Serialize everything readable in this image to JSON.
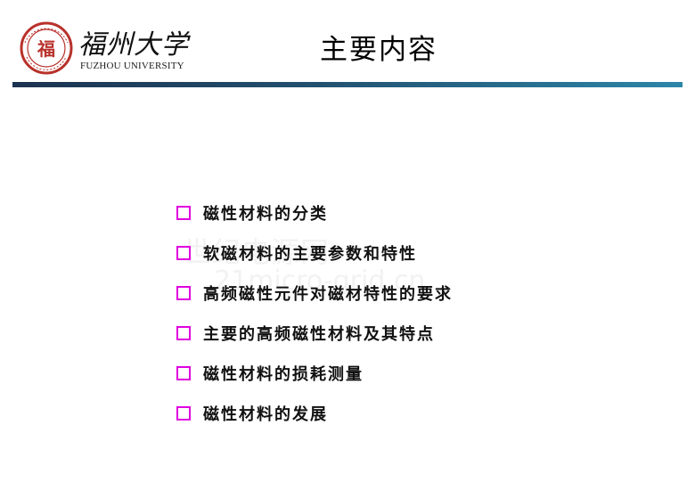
{
  "header": {
    "logo_name_script": "福州大学",
    "logo_name_en": "FUZHOU UNIVERSITY",
    "seal_glyph": "福",
    "title": "主要内容",
    "bar_color_start": "#1b3350",
    "bar_color_end": "#2c86a8"
  },
  "topics": [
    {
      "label": "磁性材料的分类"
    },
    {
      "label": "软磁材料的主要参数和特性"
    },
    {
      "label": "高频磁性元件对磁材特性的要求"
    },
    {
      "label": "主要的高频磁性材料及其特点"
    },
    {
      "label": "磁性材料的损耗测量"
    },
    {
      "label": "磁性材料的发展"
    }
  ],
  "bullet_color": "#e000e0",
  "watermark": {
    "line1": "世纪电源网",
    "line2": "21micro-grid.cn"
  }
}
